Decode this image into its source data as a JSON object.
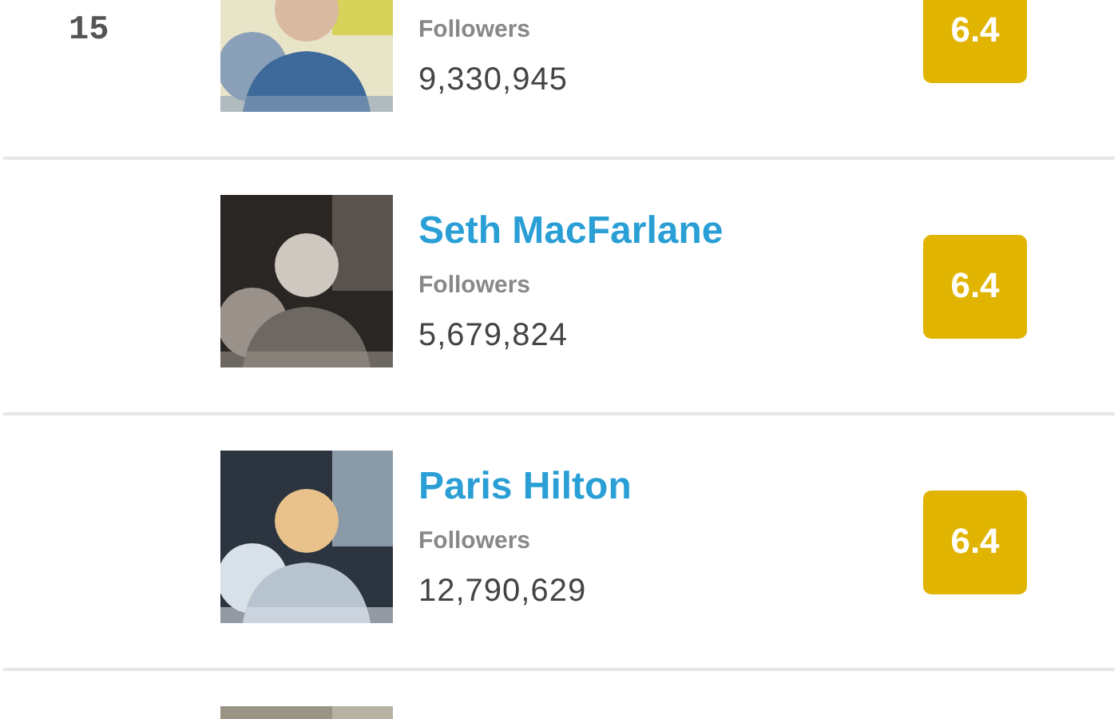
{
  "rows": [
    {
      "rank": "15",
      "photo": {
        "kind": "picture"
      },
      "followers_label": "Followers",
      "followers": "9,330,945",
      "score": "6.4"
    },
    {
      "photo": {
        "kind": "picture"
      },
      "name": "Seth MacFarlane",
      "followers_label": "Followers",
      "followers": "5,679,824",
      "score": "6.4"
    },
    {
      "photo": {
        "kind": "picture"
      },
      "name": "Paris Hilton",
      "followers_label": "Followers",
      "followers": "12,790,629",
      "score": "6.4"
    },
    {
      "photo": {
        "kind": "picture"
      }
    }
  ]
}
